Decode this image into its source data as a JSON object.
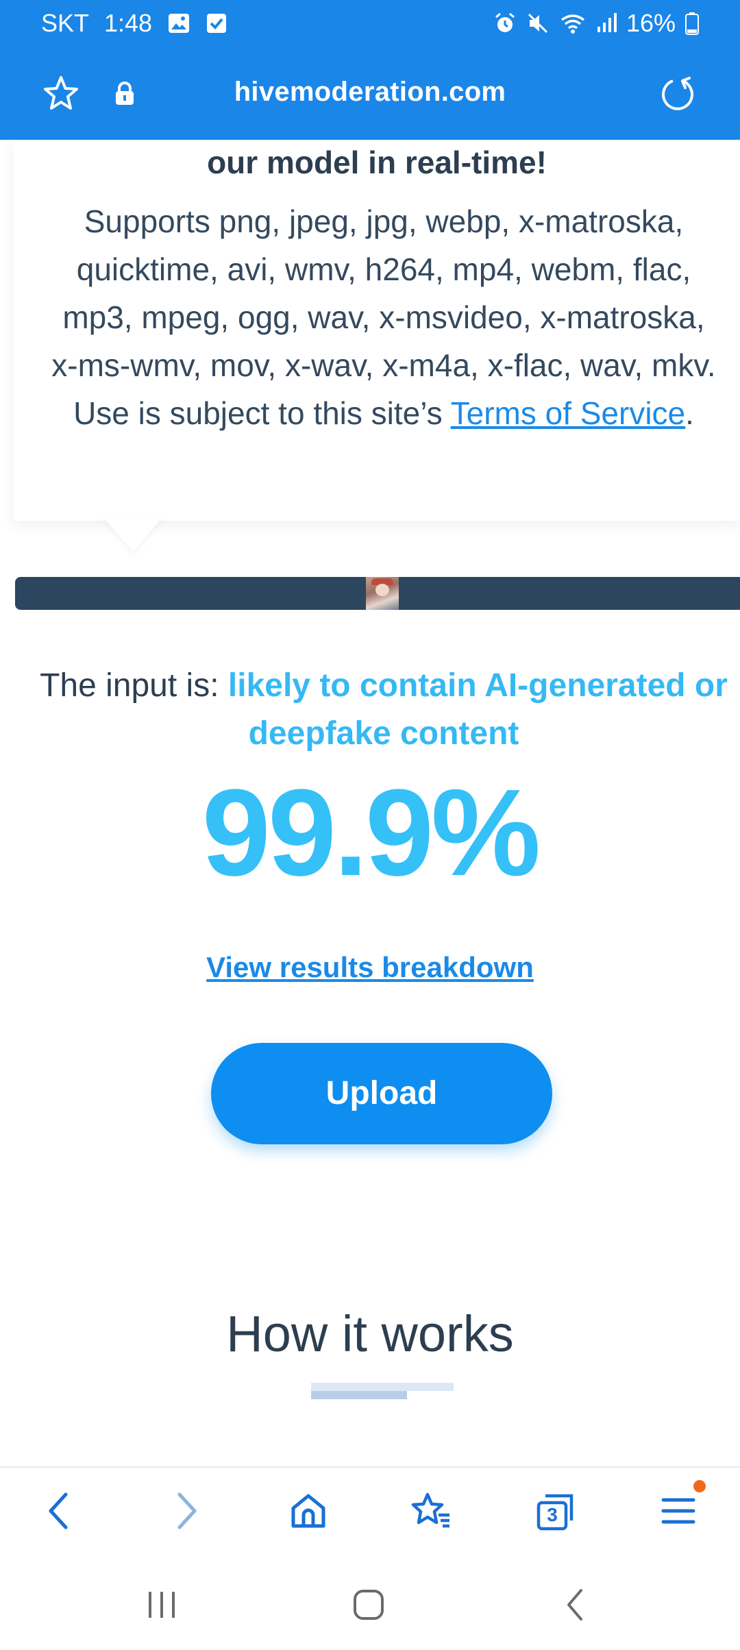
{
  "status_bar": {
    "carrier": "SKT",
    "time": "1:48",
    "battery": "16%",
    "icons": [
      "gallery-icon",
      "check-icon",
      "alarm-icon",
      "mute-icon",
      "wifi-icon",
      "signal-icon",
      "battery-icon"
    ]
  },
  "browser": {
    "url": "hivemoderation.com",
    "icons": [
      "star-icon",
      "lock-icon",
      "reload-icon"
    ]
  },
  "card": {
    "heading": "our model in real-time!",
    "body_text": "Supports png, jpeg, jpg, webp, x-matroska, quicktime, avi, wmv, h264, mp4, webm, flac, mp3, mpeg, ogg, wav, x-msvideo, x-matroska, x-ms-wmv, mov, x-wav, x-m4a, x-flac, wav, mkv. Use is subject to this site’s ",
    "tos_link": "Terms of Service",
    "tos_suffix": "."
  },
  "result": {
    "prefix": "The input is: ",
    "verdict": "likely to contain AI-generated or deepfake content",
    "percentage": "99.9%",
    "breakdown_link": "View results breakdown",
    "upload_label": "Upload"
  },
  "how_it_works": {
    "heading": "How it works"
  },
  "toolbar": {
    "tab_count": "3",
    "icons": [
      "back-icon",
      "forward-icon",
      "home-icon",
      "bookmarks-icon",
      "tabs-icon",
      "menu-icon"
    ]
  },
  "colors": {
    "brand_blue": "#1a86e8",
    "accent_cyan": "#35c0f7",
    "button_blue": "#0e8ef0",
    "text_dark": "#2c3e50",
    "notification_dot": "#f06a1e"
  }
}
